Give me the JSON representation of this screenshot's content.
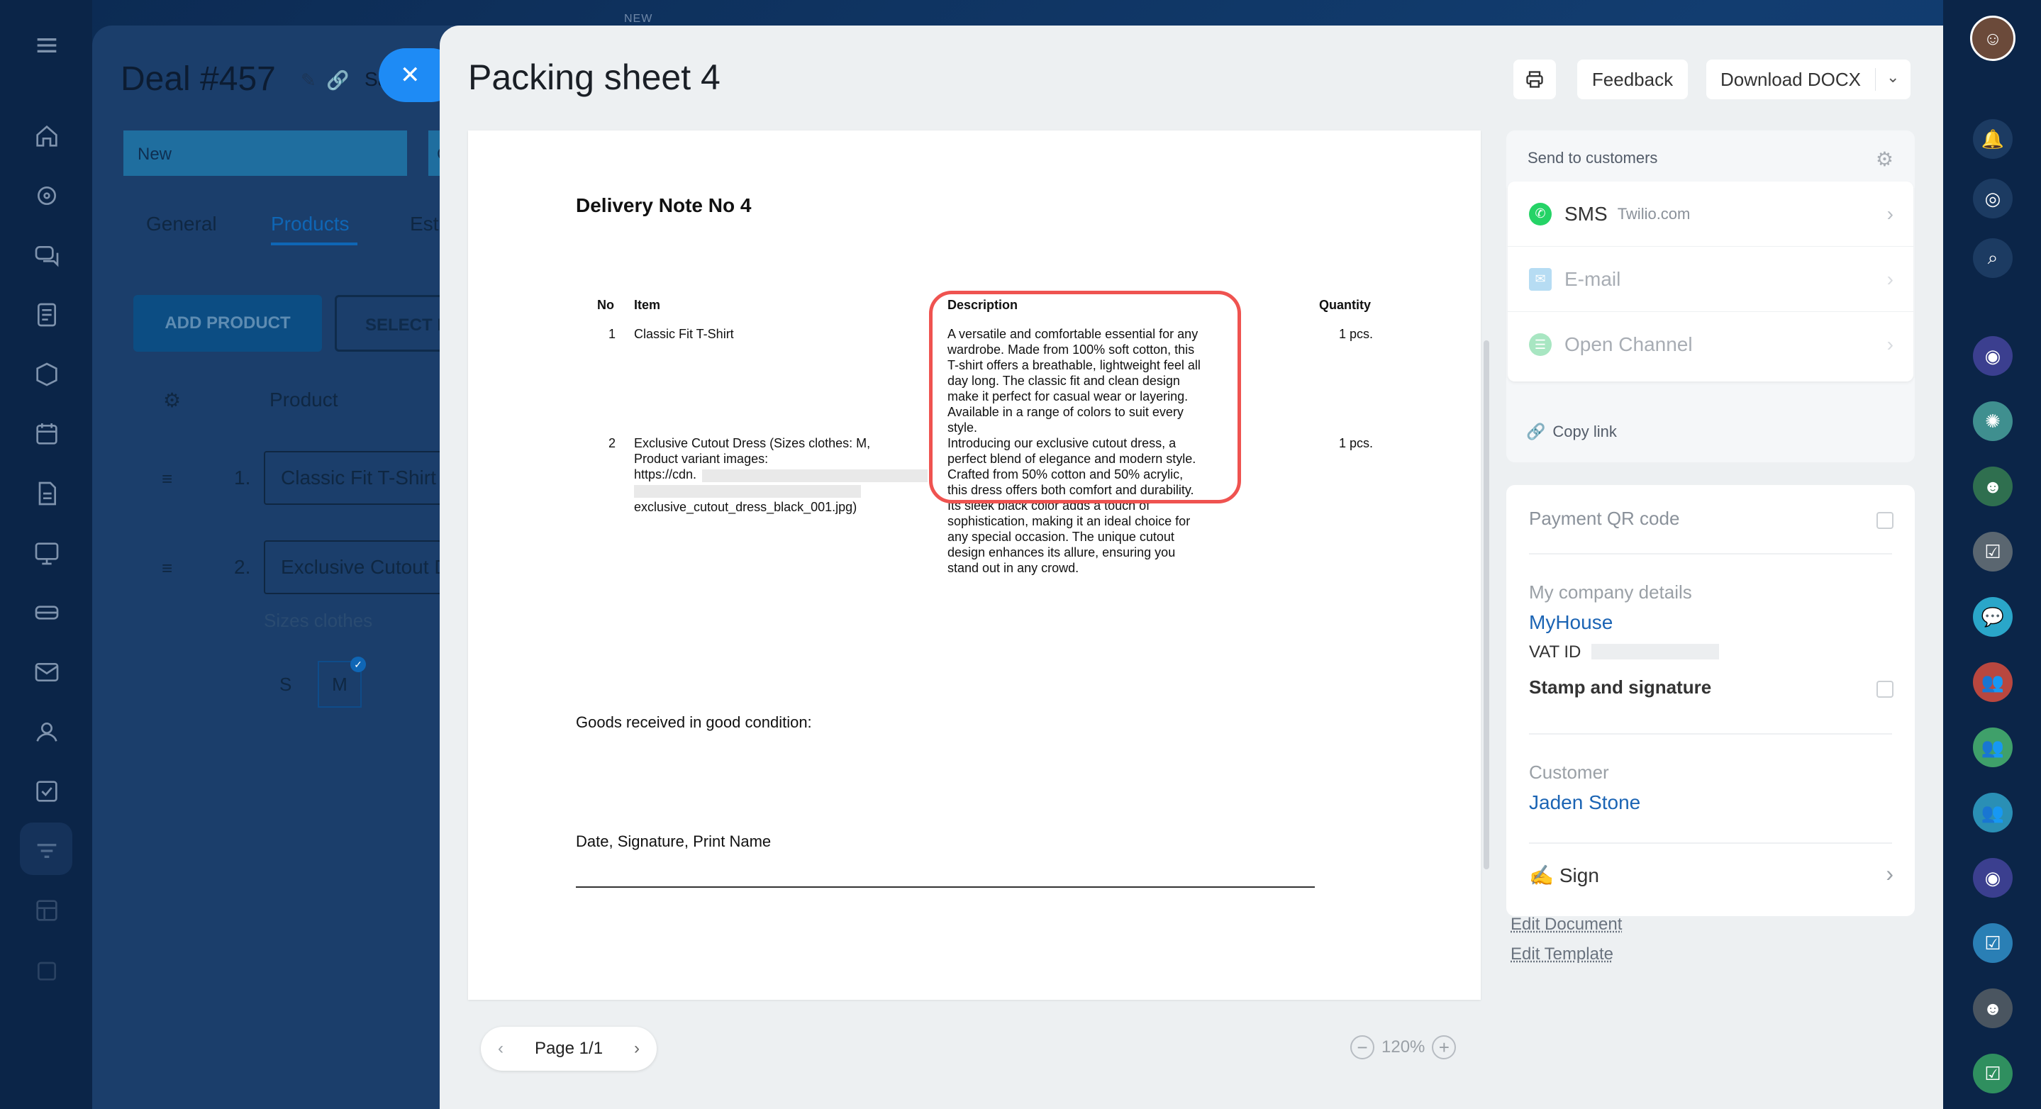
{
  "top_label": "NEW",
  "deal": {
    "title": "Deal #457",
    "title_suffix": "Sa",
    "stage_new": "New",
    "stage_next": "C",
    "tabs": [
      "General",
      "Products",
      "Est"
    ],
    "add_product": "ADD PRODUCT",
    "select_product": "SELECT I",
    "col_product": "Product",
    "rows": [
      {
        "n": "1.",
        "name": "Classic Fit T-Shirt"
      },
      {
        "n": "2.",
        "name": "Exclusive Cutout Dress"
      }
    ],
    "sizes_label": "Sizes clothes",
    "size_s": "S",
    "size_m": "M"
  },
  "slider": {
    "title": "Packing sheet 4",
    "feedback": "Feedback",
    "download": "Download DOCX"
  },
  "document": {
    "heading": "Delivery Note No 4",
    "col_no": "No",
    "col_item": "Item",
    "col_description": "Description",
    "col_quantity": "Quantity",
    "row1": {
      "no": "1",
      "item": "Classic Fit T-Shirt",
      "desc": [
        "A versatile and comfortable essential for any",
        "wardrobe. Made from 100% soft cotton, this",
        "T-shirt offers a breathable, lightweight feel all",
        "day long. The classic fit and clean design",
        "make it perfect for casual wear or layering.",
        "Available in a range of colors to suit every",
        "style."
      ],
      "qty": "1 pcs."
    },
    "row2": {
      "no": "2",
      "item": [
        "Exclusive Cutout Dress (Sizes clothes: M,",
        "Product variant images:",
        "https://cdn."
      ],
      "item_file": "exclusive_cutout_dress_black_001.jpg)",
      "desc": [
        "Introducing our exclusive cutout dress, a",
        "perfect blend of elegance and modern style.",
        "Crafted from 50% cotton and 50% acrylic,",
        "this dress offers both comfort and durability.",
        "Its sleek black color adds a touch of",
        "sophistication, making it an ideal choice for",
        "any special occasion. The unique cutout",
        "design enhances its allure, ensuring you",
        "stand out in any crowd."
      ],
      "qty": "1 pcs."
    },
    "goods_received": "Goods received in good condition:",
    "signature_caption": "Date, Signature, Print Name"
  },
  "pager": {
    "label": "Page 1/1"
  },
  "zoom": {
    "level": "120%"
  },
  "send": {
    "title": "Send to customers",
    "sms": "SMS",
    "sms_provider": "Twilio.com",
    "email": "E-mail",
    "open_channel": "Open Channel",
    "copy_link": "Copy link"
  },
  "details": {
    "payment_qr": "Payment QR code",
    "company_label": "My company details",
    "company": "MyHouse",
    "vat": "VAT ID",
    "stamp": "Stamp and signature",
    "customer_label": "Customer",
    "customer": "Jaden Stone",
    "sign": "Sign"
  },
  "links": {
    "edit_document": "Edit Document",
    "edit_template": "Edit Template"
  },
  "colors": {
    "accent": "#1e8bf5",
    "highlight": "#ef5350",
    "link": "#1b64b4"
  }
}
